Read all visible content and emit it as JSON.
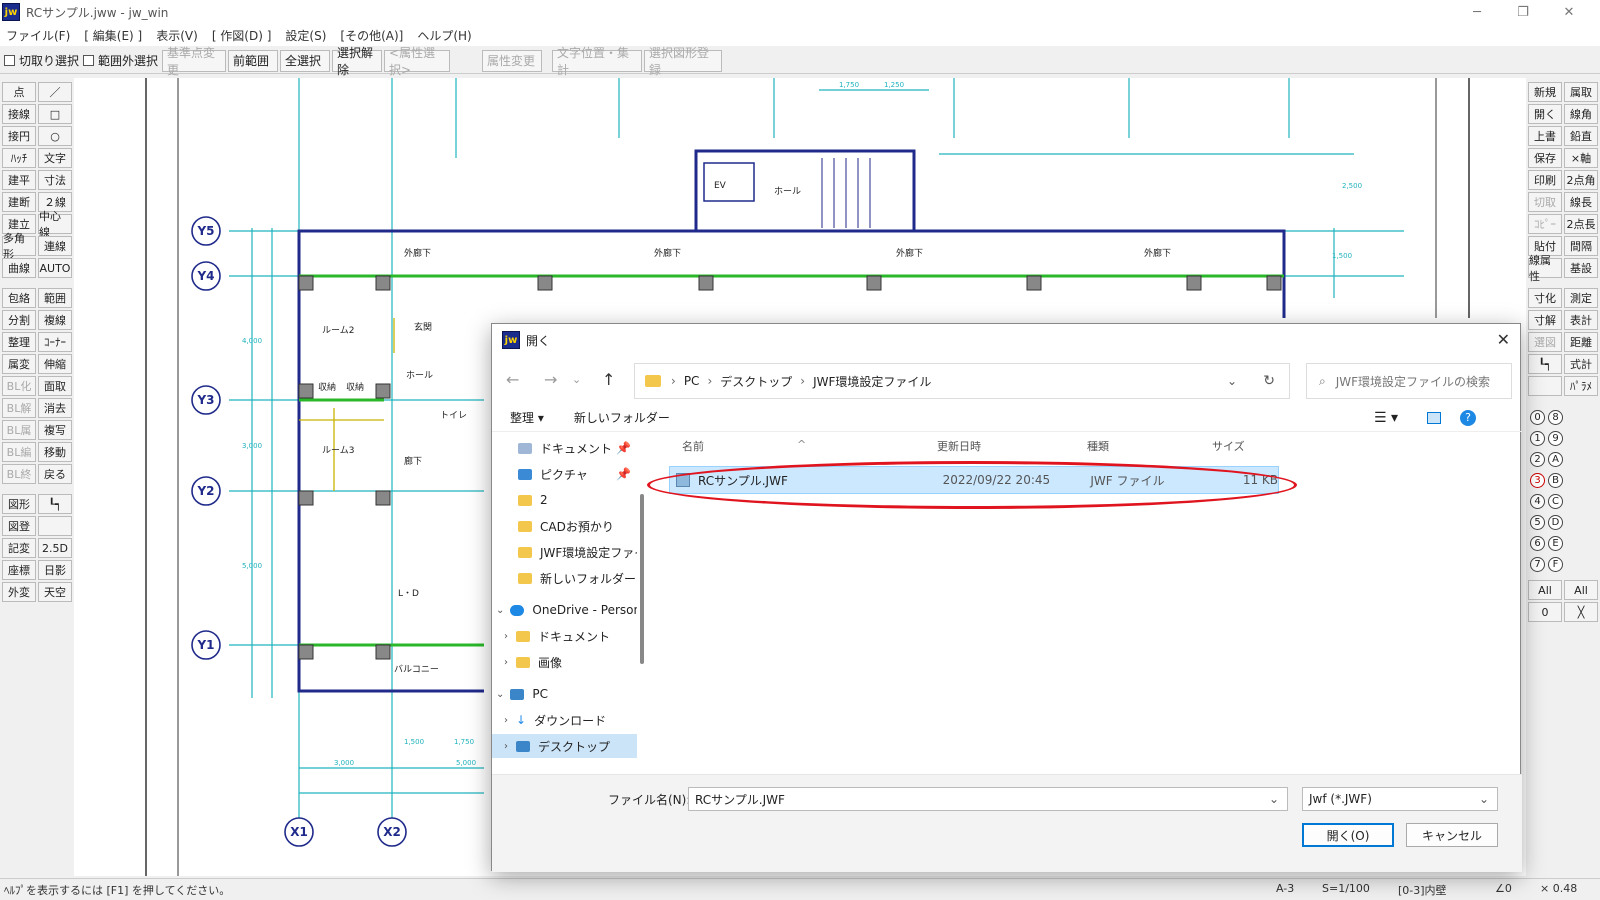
{
  "window": {
    "title": "RCサンプル.jww - jw_win",
    "app_icon_text": "jw"
  },
  "menu": [
    "ファイル(F)",
    "[ 編集(E) ]",
    "表示(V)",
    "[ 作図(D) ]",
    "設定(S)",
    "[その他(A)]",
    "ヘルプ(H)"
  ],
  "toolbar": {
    "checkboxes": [
      "切取り選択",
      "範囲外選択"
    ],
    "buttons": [
      {
        "label": "基準点変更",
        "enabled": false
      },
      {
        "label": "前範囲",
        "enabled": true
      },
      {
        "label": "全選択",
        "enabled": true
      },
      {
        "label": "選択解除",
        "enabled": true
      },
      {
        "label": "<属性選択>",
        "enabled": false
      },
      {
        "label": "属性変更",
        "enabled": false
      },
      {
        "label": "文字位置・集計",
        "enabled": false
      },
      {
        "label": "選択図形登録",
        "enabled": false
      }
    ]
  },
  "left_tools": [
    [
      "点",
      "／"
    ],
    [
      "接線",
      "□"
    ],
    [
      "接円",
      "○"
    ],
    [
      "ﾊｯﾁ",
      "文字"
    ],
    [
      "建平",
      "寸法"
    ],
    [
      "建断",
      "２線"
    ],
    [
      "建立",
      "中心線"
    ],
    [
      "多角形",
      "連線"
    ],
    [
      "曲線",
      "AUTO"
    ],
    [
      "包絡",
      "範囲"
    ],
    [
      "分割",
      "複線"
    ],
    [
      "整理",
      "ｺｰﾅｰ"
    ],
    [
      "属変",
      "伸縮"
    ],
    [
      "BL化",
      "面取"
    ],
    [
      "BL解",
      "消去"
    ],
    [
      "BL属",
      "複写"
    ],
    [
      "BL編",
      "移動"
    ],
    [
      "BL終",
      "戻る"
    ],
    [
      "図形",
      "┖┑"
    ],
    [
      "図登",
      ""
    ],
    [
      "記変",
      "2.5D"
    ],
    [
      "座標",
      "日影"
    ],
    [
      "外変",
      "天空"
    ]
  ],
  "right_tools": [
    [
      "新規",
      "属取"
    ],
    [
      "開く",
      "線角"
    ],
    [
      "上書",
      "鉛直"
    ],
    [
      "保存",
      "×軸"
    ],
    [
      "印刷",
      "2点角"
    ],
    [
      "切取",
      "線長"
    ],
    [
      "ｺﾋﾟｰ",
      "2点長"
    ],
    [
      "貼付",
      "間隔"
    ],
    [
      "線属性",
      "基設"
    ],
    [
      "寸化",
      "測定"
    ],
    [
      "寸解",
      "表計"
    ],
    [
      "選図",
      "距離"
    ],
    [
      "┖┑",
      "式計"
    ],
    [
      "",
      "ﾊﾟﾗﾒ"
    ]
  ],
  "right_layers": {
    "groups": [
      "0",
      "1",
      "2",
      "3",
      "4",
      "5",
      "6",
      "7"
    ],
    "layers": [
      "8",
      "9",
      "A",
      "B",
      "C",
      "D",
      "E",
      "F"
    ],
    "all_label": "All",
    "zero_label": "0"
  },
  "drawing": {
    "row_labels": [
      "Y5",
      "Y4",
      "Y3",
      "Y2",
      "Y1"
    ],
    "col_labels": [
      "X1",
      "X2"
    ],
    "room_labels": [
      "外廊下",
      "外廊下",
      "外廊下",
      "外廊下",
      "ルーム2",
      "ルーム3",
      "玄関",
      "ホール",
      "収納",
      "収納",
      "トイレ",
      "廊下",
      "L・D",
      "バルコニー",
      "ホール",
      "EV"
    ],
    "dims": [
      "3,000",
      "5,000",
      "1,500",
      "1,750",
      "1,750",
      "1,250",
      "2,500",
      "1,500",
      "4,000",
      "3,000",
      "5,000"
    ]
  },
  "status": {
    "help": "ﾍﾙﾌﾟを表示するには [F1] を押してください。",
    "paper": "A-3",
    "scale": "S=1/100",
    "layer": "[0-3]内壁",
    "angle": "∠0",
    "zoom": "× 0.48"
  },
  "dialog": {
    "title": "開く",
    "breadcrumbs": [
      "PC",
      "デスクトップ",
      "JWF環境設定ファイル"
    ],
    "search_placeholder": "JWF環境設定ファイルの検索",
    "commands": {
      "organize": "整理 ▾",
      "new_folder": "新しいフォルダー"
    },
    "nav": [
      {
        "label": "ドキュメント",
        "pinned": true
      },
      {
        "label": "ピクチャ",
        "pinned": true
      },
      {
        "label": "2",
        "pinned": false
      },
      {
        "label": "CADお預かり",
        "pinned": false
      },
      {
        "label": "JWF環境設定ファイル",
        "pinned": false
      },
      {
        "label": "新しいフォルダー",
        "pinned": false
      },
      {
        "label": "OneDrive - Personal",
        "pinned": false
      },
      {
        "label": "ドキュメント",
        "pinned": false
      },
      {
        "label": "画像",
        "pinned": false
      },
      {
        "label": "PC",
        "pinned": false
      },
      {
        "label": "ダウンロード",
        "pinned": false
      },
      {
        "label": "デスクトップ",
        "pinned": false
      }
    ],
    "columns": [
      "名前",
      "更新日時",
      "種類",
      "サイズ"
    ],
    "files": [
      {
        "name": "RCサンプル.JWF",
        "modified": "2022/09/22 20:45",
        "type": "JWF ファイル",
        "size": "11 KB"
      }
    ],
    "filename_label": "ファイル名(N):",
    "filename_value": "RCサンプル.JWF",
    "filter_value": "Jwf (*.JWF)",
    "open_label": "開く(O)",
    "cancel_label": "キャンセル"
  },
  "colors": {
    "wall": "#1f2a8a",
    "cyan": "#1fb3bd",
    "green": "#2ab82a",
    "annot": "#e0141e",
    "selection": "#cce8ff"
  }
}
